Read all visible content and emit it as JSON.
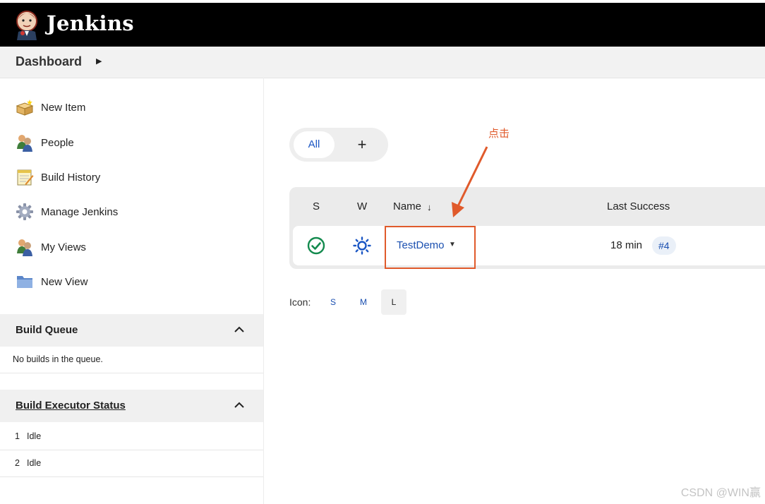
{
  "header": {
    "brand": "Jenkins",
    "logo_icon": "jenkins-butler-logo"
  },
  "breadcrumb": {
    "item": "Dashboard"
  },
  "sidebar": {
    "tasks": [
      {
        "label": "New Item",
        "icon": "new-item-box-icon"
      },
      {
        "label": "People",
        "icon": "people-icon"
      },
      {
        "label": "Build History",
        "icon": "notepad-icon"
      },
      {
        "label": "Manage Jenkins",
        "icon": "gear-icon"
      },
      {
        "label": "My Views",
        "icon": "people-icon"
      },
      {
        "label": "New View",
        "icon": "folder-icon"
      }
    ],
    "build_queue": {
      "title": "Build Queue",
      "empty_text": "No builds in the queue."
    },
    "executors": {
      "title": "Build Executor Status",
      "rows": [
        {
          "num": "1",
          "status": "Idle"
        },
        {
          "num": "2",
          "status": "Idle"
        }
      ]
    }
  },
  "views": {
    "tabs": [
      "All"
    ],
    "add_tab": "+"
  },
  "jobs_table": {
    "columns": {
      "s": "S",
      "w": "W",
      "name": "Name",
      "sort_indicator": "↓",
      "last_success": "Last Success"
    },
    "rows": [
      {
        "status_icon": "success-check-icon",
        "weather_icon": "sunny-weather-icon",
        "name": "TestDemo",
        "last_success": "18 min",
        "build": "#4"
      }
    ]
  },
  "icon_size": {
    "label": "Icon:",
    "options": [
      "S",
      "M",
      "L"
    ],
    "selected": "L"
  },
  "annotation": {
    "text": "点击",
    "color": "#e05a2b"
  },
  "watermark": "CSDN @WIN赢",
  "colors": {
    "link": "#1a4fb0",
    "success": "#138a4e",
    "header_bg": "#000000"
  }
}
